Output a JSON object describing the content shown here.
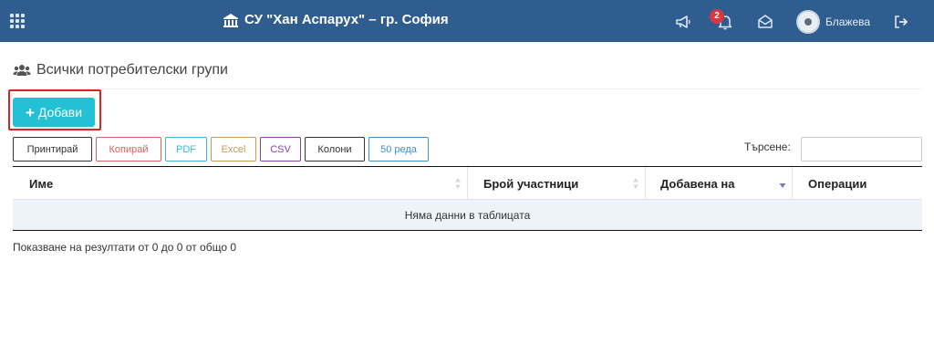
{
  "header": {
    "school_name": "СУ \"Хан Аспарух\" – гр. София",
    "notification_count": "2",
    "username": "Блажева"
  },
  "page": {
    "title": "Всички потребителски групи"
  },
  "toolbar": {
    "add_label": "Добави",
    "buttons": [
      {
        "label": "Принтирай",
        "color": "#333333"
      },
      {
        "label": "Копирай",
        "color": "#e0625a"
      },
      {
        "label": "PDF",
        "color": "#3bb8dc"
      },
      {
        "label": "Excel",
        "color": "#c89a52"
      },
      {
        "label": "CSV",
        "color": "#8b3fa6"
      },
      {
        "label": "Колони",
        "color": "#333333"
      },
      {
        "label": "50 реда",
        "color": "#3c8fd0"
      }
    ],
    "search_label": "Търсене:",
    "search_value": ""
  },
  "table": {
    "columns": [
      "Име",
      "Брой участници",
      "Добавена на",
      "Операции"
    ],
    "empty_message": "Няма данни в таблицата"
  },
  "footer": {
    "info": "Показване на резултати от 0 до 0 от общо 0"
  },
  "colors": {
    "navbar": "#2f5d8f",
    "add_button": "#24c1d6",
    "highlight": "#d62525",
    "sort_active": "#6a7fc8"
  }
}
